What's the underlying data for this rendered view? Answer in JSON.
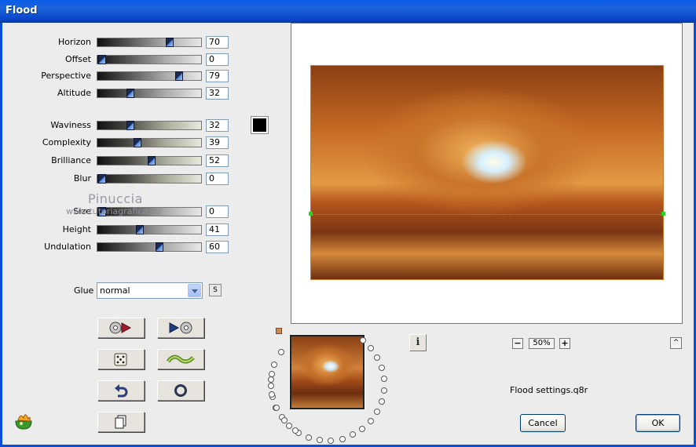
{
  "window": {
    "title": "Flood"
  },
  "sliders": [
    {
      "id": "horizon",
      "label": "Horizon",
      "value": "70",
      "level": 0.7,
      "tint": "gray"
    },
    {
      "id": "offset",
      "label": "Offset",
      "value": "0",
      "level": 0.0,
      "tint": "gray"
    },
    {
      "id": "perspective",
      "label": "Perspective",
      "value": "79",
      "level": 0.79,
      "tint": "gray"
    },
    {
      "id": "altitude",
      "label": "Altitude",
      "value": "32",
      "level": 0.32,
      "tint": "gray"
    },
    {
      "id": "waviness",
      "label": "Waviness",
      "value": "32",
      "level": 0.32,
      "tint": "olive"
    },
    {
      "id": "complexity",
      "label": "Complexity",
      "value": "39",
      "level": 0.39,
      "tint": "olive"
    },
    {
      "id": "brilliance",
      "label": "Brilliance",
      "value": "52",
      "level": 0.52,
      "tint": "olive"
    },
    {
      "id": "blur",
      "label": "Blur",
      "value": "0",
      "level": 0.0,
      "tint": "olive"
    },
    {
      "id": "size",
      "label": "Size",
      "value": "0",
      "level": 0.0,
      "tint": "gray"
    },
    {
      "id": "height",
      "label": "Height",
      "value": "41",
      "level": 0.41,
      "tint": "gray"
    },
    {
      "id": "undulation",
      "label": "Undulation",
      "value": "60",
      "level": 0.6,
      "tint": "gray"
    }
  ],
  "watermark": {
    "name": "Pinuccia",
    "url": "www.tutoriagrafica.eu"
  },
  "glue": {
    "label": "Glue",
    "value": "normal",
    "s_label": "S"
  },
  "color_swatch": "#000000",
  "preview": {
    "zoom": "50%"
  },
  "settings_file": "Flood settings.q8r",
  "buttons": {
    "cancel": "Cancel",
    "ok": "OK"
  },
  "icons": [
    "record-forward-icon",
    "play-record-icon",
    "dice-icon",
    "wave-icon",
    "undo-icon",
    "reset-circle-icon",
    "copy-page-icon",
    "info-icon",
    "app-logo-icon"
  ]
}
